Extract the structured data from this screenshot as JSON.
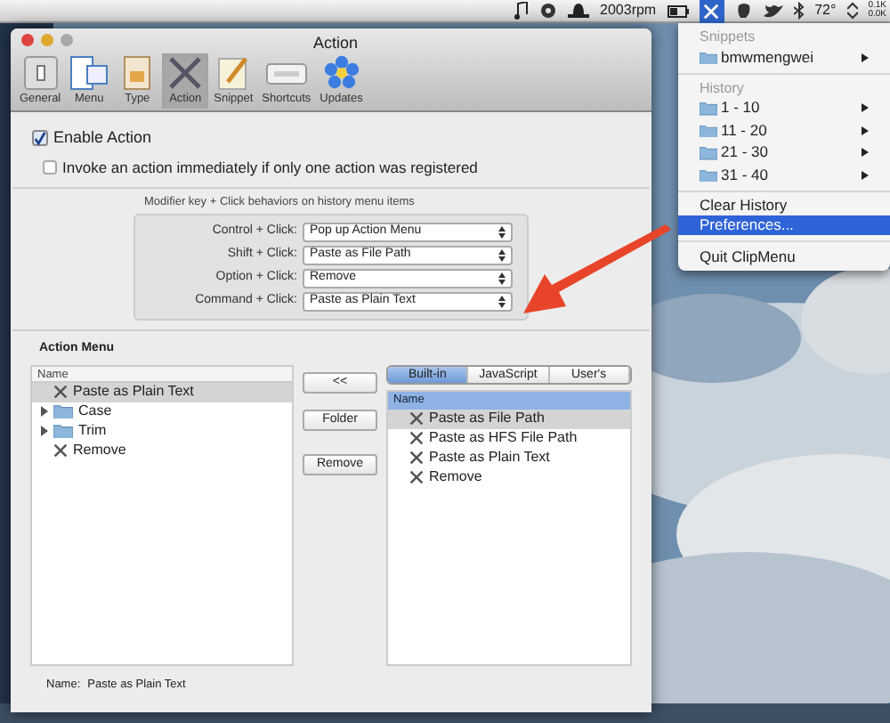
{
  "menu_bar": {
    "status_items": [
      "2003rpm",
      "72°"
    ],
    "network": [
      "0.1K",
      "0.0K"
    ]
  },
  "window": {
    "title": "Action",
    "toolbar": [
      {
        "label": "General",
        "selected": false
      },
      {
        "label": "Menu",
        "selected": false
      },
      {
        "label": "Type",
        "selected": false
      },
      {
        "label": "Action",
        "selected": true
      },
      {
        "label": "Snippet",
        "selected": false
      },
      {
        "label": "Shortcuts",
        "selected": false
      },
      {
        "label": "Updates",
        "selected": false
      }
    ],
    "enable_action": {
      "label": "Enable Action",
      "checked": true
    },
    "invoke_option": {
      "label": "Invoke an action immediately if only one action was registered",
      "checked": false
    },
    "modifier_group": {
      "caption": "Modifier key + Click behaviors on history menu items",
      "rows": [
        {
          "label": "Control + Click:",
          "value": "Pop up Action Menu"
        },
        {
          "label": "Shift + Click:",
          "value": "Paste as File Path"
        },
        {
          "label": "Option + Click:",
          "value": "Remove"
        },
        {
          "label": "Command + Click:",
          "value": "Paste as Plain Text"
        }
      ]
    },
    "action_menu": {
      "title": "Action Menu",
      "column": "Name",
      "items": [
        {
          "label": "Paste as Plain Text",
          "kind": "action",
          "selected": true
        },
        {
          "label": "Case",
          "kind": "folder",
          "expanded": false,
          "selected": false
        },
        {
          "label": "Trim",
          "kind": "folder",
          "expanded": false,
          "selected": false
        },
        {
          "label": "Remove",
          "kind": "action",
          "selected": false
        }
      ]
    },
    "buttons": [
      "<<",
      "Folder",
      "Remove"
    ],
    "source_tabs": [
      {
        "label": "Built-in",
        "selected": true
      },
      {
        "label": "JavaScript",
        "selected": false
      },
      {
        "label": "User's",
        "selected": false
      }
    ],
    "source_list": {
      "column": "Name",
      "items": [
        {
          "label": "Paste as File Path",
          "selected": true
        },
        {
          "label": "Paste as HFS File Path",
          "selected": false
        },
        {
          "label": "Paste as Plain Text",
          "selected": false
        },
        {
          "label": "Remove",
          "selected": false
        }
      ]
    },
    "footer": {
      "label": "Name:",
      "value": "Paste as Plain Text"
    }
  },
  "menu": {
    "sections": [
      {
        "header": "Snippets",
        "items": [
          {
            "label": "bmwmengwei"
          }
        ]
      },
      {
        "header": "History",
        "items": [
          {
            "label": "1 - 10"
          },
          {
            "label": "11 - 20"
          },
          {
            "label": "21 - 30"
          },
          {
            "label": "31 - 40"
          }
        ]
      }
    ],
    "commands": [
      [
        {
          "label": "Clear History",
          "selected": false
        },
        {
          "label": "Preferences...",
          "selected": true
        }
      ],
      [
        {
          "label": "Quit ClipMenu",
          "selected": false
        }
      ]
    ]
  }
}
